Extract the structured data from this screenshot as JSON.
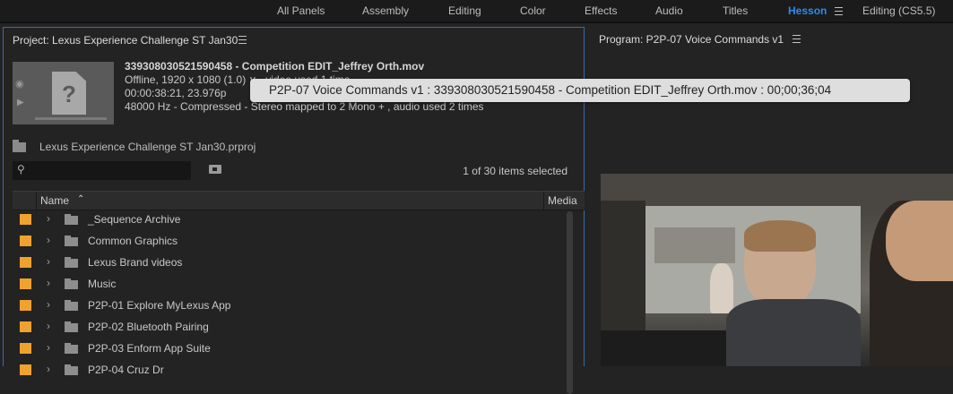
{
  "workspace_bar": {
    "items": [
      {
        "label": "All Panels"
      },
      {
        "label": "Assembly"
      },
      {
        "label": "Editing"
      },
      {
        "label": "Color"
      },
      {
        "label": "Effects"
      },
      {
        "label": "Audio"
      },
      {
        "label": "Titles"
      },
      {
        "label": "Hesson",
        "active": true
      },
      {
        "label": "Editing (CS5.5)"
      }
    ],
    "accent_color": "#2d8ceb"
  },
  "project_panel": {
    "title": "Project: Lexus Experience Challenge ST Jan30",
    "clip": {
      "name": "339308030521590458 - Competition EDIT_Jeffrey Orth.mov",
      "line2": "Offline, 1920 x 1080 (1.0) ∨ , video used 1 time",
      "line3": "00:00:38:21, 23.976p",
      "line4": "48000 Hz - Compressed - Stereo mapped to 2 Mono + , audio used 2 times"
    },
    "project_file": "Lexus Experience Challenge ST Jan30.prproj",
    "search": {
      "value": "",
      "placeholder": ""
    },
    "items_selected": "1 of 30 items selected",
    "columns": {
      "name": "Name",
      "media": "Media"
    },
    "items": [
      {
        "label": "_Sequence Archive"
      },
      {
        "label": "Common Graphics"
      },
      {
        "label": "Lexus Brand videos"
      },
      {
        "label": "Music"
      },
      {
        "label": "P2P-01 Explore MyLexus App"
      },
      {
        "label": "P2P-02 Bluetooth Pairing"
      },
      {
        "label": "P2P-03 Enform App Suite"
      },
      {
        "label": "P2P-04 Cruz Dr"
      }
    ],
    "label_color": "#f0a22e"
  },
  "program_panel": {
    "title": "Program: P2P-07 Voice Commands v1"
  },
  "tooltip": {
    "text": "P2P-07 Voice Commands v1 : 339308030521590458 - Competition EDIT_Jeffrey Orth.mov : 00;00;36;04"
  }
}
